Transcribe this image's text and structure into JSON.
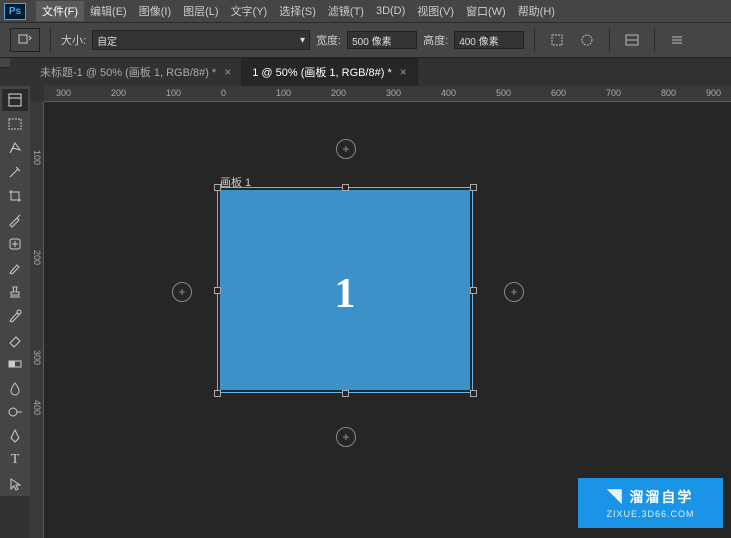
{
  "menu": {
    "logo": "Ps",
    "items": [
      "文件(F)",
      "编辑(E)",
      "图像(I)",
      "图层(L)",
      "文字(Y)",
      "选择(S)",
      "滤镜(T)",
      "3D(D)",
      "视图(V)",
      "窗口(W)",
      "帮助(H)"
    ],
    "active_index": 0
  },
  "options": {
    "size_label": "大小:",
    "size_value": "自定",
    "width_label": "宽度:",
    "width_value": "500 像素",
    "height_label": "高度:",
    "height_value": "400 像素"
  },
  "tabs": [
    {
      "label": "未标题-1 @ 50% (画板 1, RGB/8#) *"
    },
    {
      "label": "1 @ 50% (画板 1, RGB/8#) *"
    }
  ],
  "active_tab": 1,
  "artboard": {
    "label": "画板 1",
    "content": "1"
  },
  "ruler_h": [
    300,
    200,
    100,
    0,
    100,
    200,
    300,
    400,
    500,
    600,
    700,
    800,
    900
  ],
  "ruler_v": [
    100,
    200,
    300,
    400
  ],
  "watermark": {
    "top": "溜溜自学",
    "sub": "ZIXUE.3D66.COM"
  }
}
